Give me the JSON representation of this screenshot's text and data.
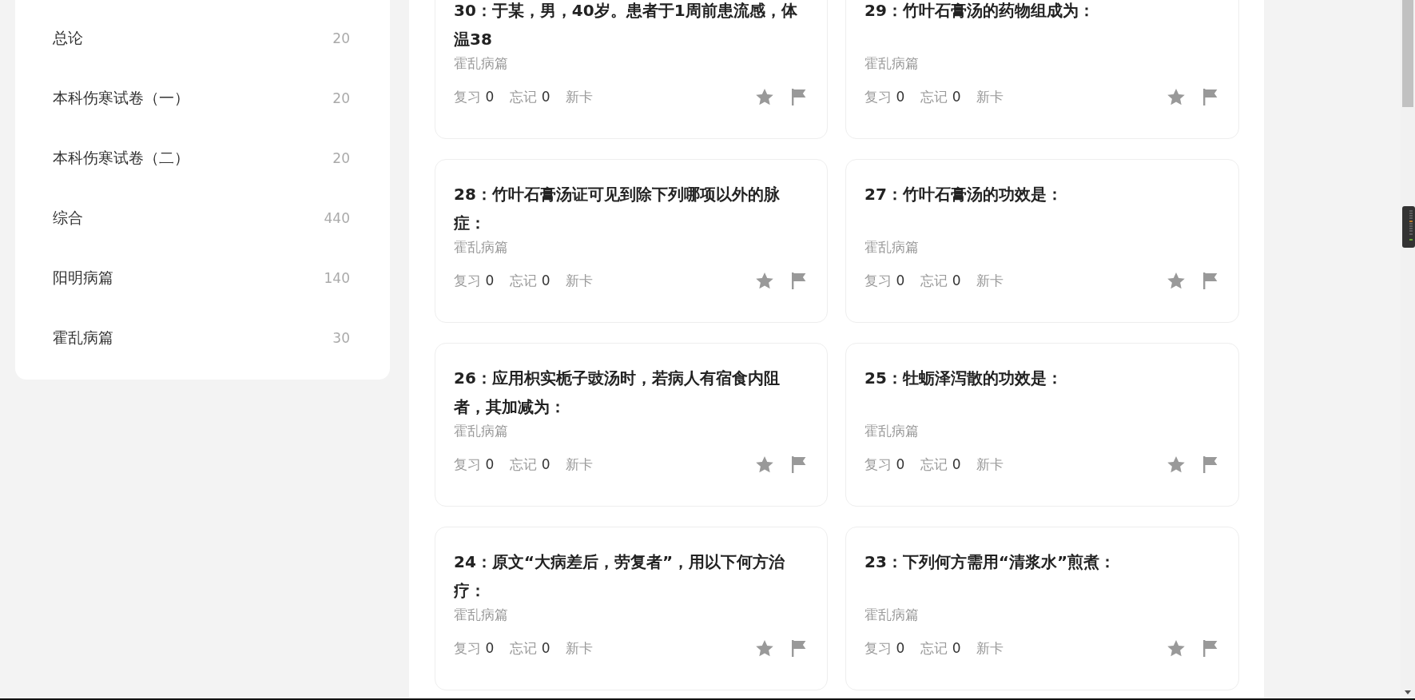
{
  "sidebar": {
    "items": [
      {
        "label": "总论",
        "count": "20"
      },
      {
        "label": "本科伤寒试卷（一）",
        "count": "20"
      },
      {
        "label": "本科伤寒试卷（二）",
        "count": "20"
      },
      {
        "label": "综合",
        "count": "440"
      },
      {
        "label": "阳明病篇",
        "count": "140"
      },
      {
        "label": "霍乱病篇",
        "count": "30"
      }
    ]
  },
  "cards": [
    {
      "title": "30：于某，男，40岁。患者于1周前患流感，体温38",
      "category": "霍乱病篇",
      "review_label": "复习",
      "review_count": "0",
      "forget_label": "忘记",
      "forget_count": "0",
      "new_label": "新卡"
    },
    {
      "title": "29：竹叶石膏汤的药物组成为：",
      "category": "霍乱病篇",
      "review_label": "复习",
      "review_count": "0",
      "forget_label": "忘记",
      "forget_count": "0",
      "new_label": "新卡"
    },
    {
      "title": "28：竹叶石膏汤证可见到除下列哪项以外的脉症：",
      "category": "霍乱病篇",
      "review_label": "复习",
      "review_count": "0",
      "forget_label": "忘记",
      "forget_count": "0",
      "new_label": "新卡"
    },
    {
      "title": "27：竹叶石膏汤的功效是：",
      "category": "霍乱病篇",
      "review_label": "复习",
      "review_count": "0",
      "forget_label": "忘记",
      "forget_count": "0",
      "new_label": "新卡"
    },
    {
      "title": "26：应用枳实栀子豉汤时，若病人有宿食内阻者，其加减为：",
      "category": "霍乱病篇",
      "review_label": "复习",
      "review_count": "0",
      "forget_label": "忘记",
      "forget_count": "0",
      "new_label": "新卡"
    },
    {
      "title": "25：牡蛎泽泻散的功效是：",
      "category": "霍乱病篇",
      "review_label": "复习",
      "review_count": "0",
      "forget_label": "忘记",
      "forget_count": "0",
      "new_label": "新卡"
    },
    {
      "title": "24：原文“大病差后，劳复者”，用以下何方治疗：",
      "category": "霍乱病篇",
      "review_label": "复习",
      "review_count": "0",
      "forget_label": "忘记",
      "forget_count": "0",
      "new_label": "新卡"
    },
    {
      "title": "23：下列何方需用“清浆水”煎煮：",
      "category": "霍乱病篇",
      "review_label": "复习",
      "review_count": "0",
      "forget_label": "忘记",
      "forget_count": "0",
      "new_label": "新卡"
    }
  ]
}
